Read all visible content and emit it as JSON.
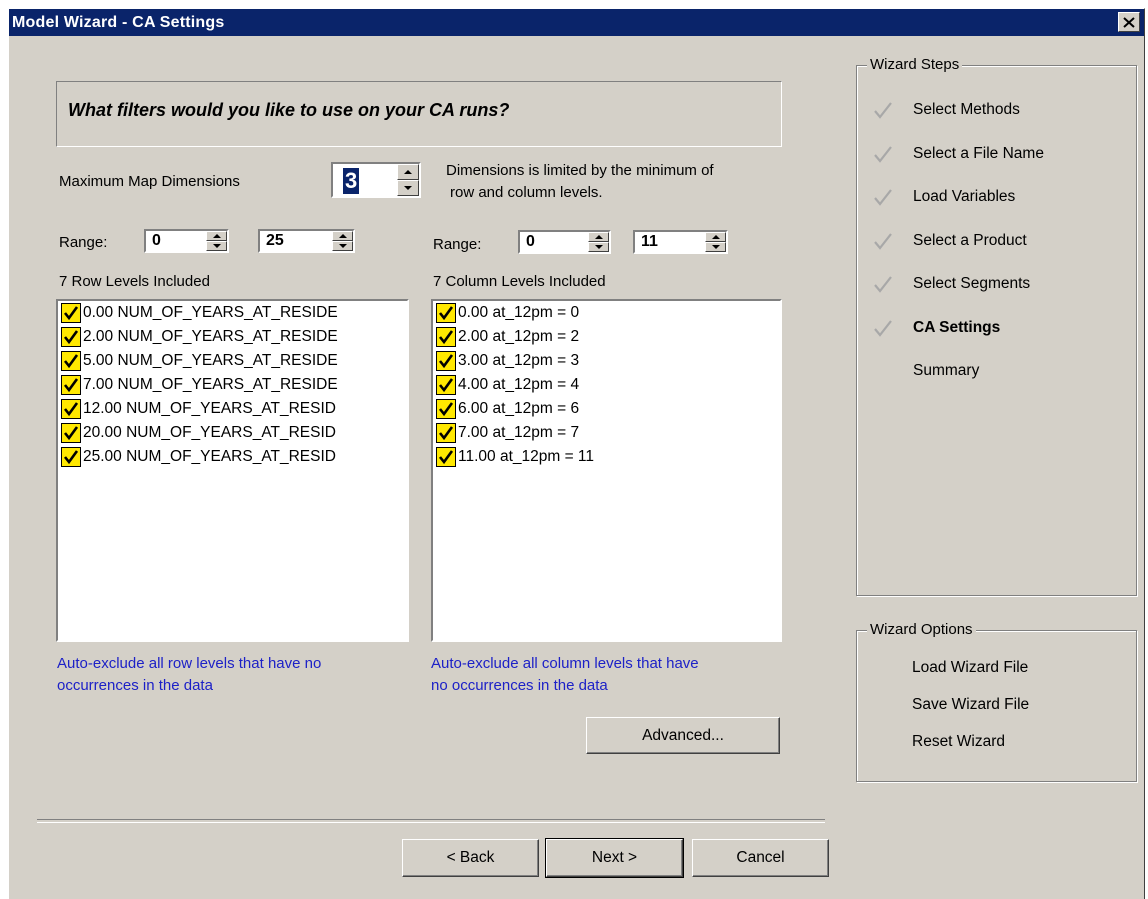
{
  "window": {
    "title": "Model Wizard - CA Settings"
  },
  "question": "What filters would you like to use on your CA runs?",
  "max_dimensions": {
    "label": "Maximum Map Dimensions",
    "value": "3",
    "note_line1": "Dimensions is limited by the minimum of",
    "note_line2": "row and column levels."
  },
  "row_panel": {
    "range_label": "Range:",
    "range_min": "0",
    "range_max": "25",
    "heading": "7 Row Levels Included",
    "items": [
      {
        "label": "0.00  NUM_OF_YEARS_AT_RESIDE",
        "checked": true
      },
      {
        "label": "2.00  NUM_OF_YEARS_AT_RESIDE",
        "checked": true
      },
      {
        "label": "5.00  NUM_OF_YEARS_AT_RESIDE",
        "checked": true
      },
      {
        "label": "7.00  NUM_OF_YEARS_AT_RESIDE",
        "checked": true
      },
      {
        "label": "12.00  NUM_OF_YEARS_AT_RESID",
        "checked": true
      },
      {
        "label": "20.00  NUM_OF_YEARS_AT_RESID",
        "checked": true
      },
      {
        "label": "25.00  NUM_OF_YEARS_AT_RESID",
        "checked": true
      }
    ],
    "auto_exclude_line1": "Auto-exclude all row levels that have no",
    "auto_exclude_line2": "occurrences in the data"
  },
  "column_panel": {
    "range_label": "Range:",
    "range_min": "0",
    "range_max": "11",
    "heading": "7 Column Levels Included",
    "items": [
      {
        "label": "0.00  at_12pm = 0",
        "checked": true
      },
      {
        "label": "2.00  at_12pm = 2",
        "checked": true
      },
      {
        "label": "3.00  at_12pm = 3",
        "checked": true
      },
      {
        "label": "4.00  at_12pm = 4",
        "checked": true
      },
      {
        "label": "6.00  at_12pm = 6",
        "checked": true
      },
      {
        "label": "7.00  at_12pm = 7",
        "checked": true
      },
      {
        "label": "11.00  at_12pm = 11",
        "checked": true
      }
    ],
    "auto_exclude_line1": "Auto-exclude all column levels that have",
    "auto_exclude_line2": "no occurrences in the data"
  },
  "buttons": {
    "advanced": "Advanced...",
    "back": "< Back",
    "next": "Next >",
    "cancel": "Cancel"
  },
  "wizard_steps": {
    "title": "Wizard Steps",
    "items": [
      {
        "label": "Select Methods",
        "done": true
      },
      {
        "label": "Select a File Name",
        "done": true
      },
      {
        "label": "Load Variables",
        "done": true
      },
      {
        "label": "Select a Product",
        "done": true
      },
      {
        "label": "Select Segments",
        "done": true
      },
      {
        "label": "CA Settings",
        "done": true,
        "current": true
      },
      {
        "label": "Summary",
        "done": false
      }
    ]
  },
  "wizard_options": {
    "title": "Wizard Options",
    "items": [
      "Load Wizard File",
      "Save Wizard File",
      "Reset Wizard"
    ]
  },
  "colors": {
    "titlebar": "#0a246a",
    "face": "#d4d0c8",
    "link": "#1d21c7",
    "checkbox": "#ffe800"
  }
}
